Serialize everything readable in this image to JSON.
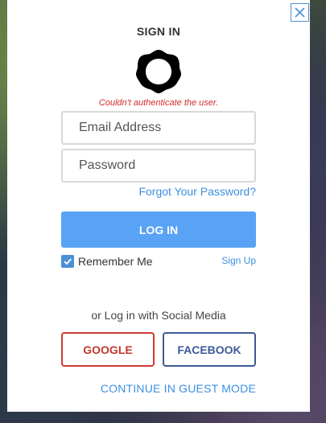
{
  "dialog": {
    "title": "SIGN IN",
    "close_icon": "close-icon",
    "logo_icon": "app-logo",
    "error_message": "Couldn't authenticate the user."
  },
  "form": {
    "email": {
      "placeholder": "Email Address",
      "value": ""
    },
    "password": {
      "placeholder": "Password",
      "value": ""
    },
    "forgot_password": "Forgot Your Password?",
    "login_label": "LOG IN",
    "remember_me": {
      "label": "Remember Me",
      "checked": true
    },
    "sign_up": "Sign Up"
  },
  "social": {
    "label": "or Log in with Social Media",
    "google": "GOOGLE",
    "facebook": "FACEBOOK"
  },
  "guest_mode": "CONTINUE IN GUEST MODE",
  "colors": {
    "accent": "#58a3f5",
    "link": "#3d8fe0",
    "error": "#d42a2a",
    "google": "#cf3b33",
    "facebook": "#3d5998"
  }
}
